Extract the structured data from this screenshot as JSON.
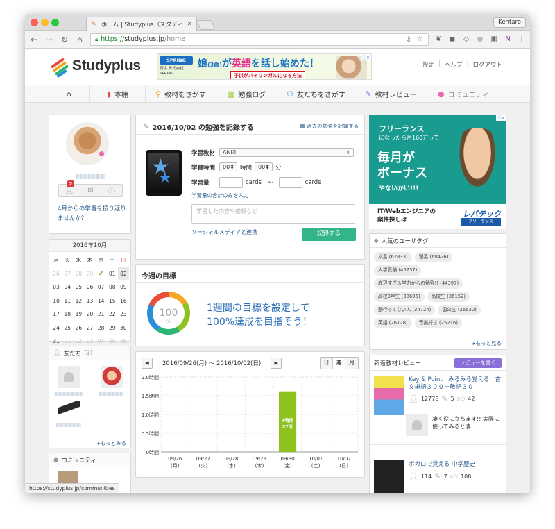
{
  "browser": {
    "tab_title": "ホーム | Studyplus（スタディプ",
    "user": "Kentaro",
    "url_scheme": "https://",
    "url_host": "studyplus.jp",
    "url_path": "/home",
    "status_url": "https://studyplus.jp/communities"
  },
  "header": {
    "logo": "Studyplus",
    "ad": {
      "brand": "SPRING",
      "brand_sub": "提供 株式会社SPRING",
      "headline_a": "娘",
      "headline_age": "(3歳)",
      "headline_b": "が",
      "headline_c": "英語",
      "headline_d": "を話し始めた！",
      "subline": "子供がバイリンガルになる方法"
    },
    "links": [
      "設定",
      "ヘルプ",
      "ログアウト"
    ]
  },
  "nav": [
    {
      "label": "",
      "icon": "home-icon"
    },
    {
      "label": "本棚",
      "icon": "book-icon"
    },
    {
      "label": "教材をさがす",
      "icon": "search-icon"
    },
    {
      "label": "勉強ログ",
      "icon": "bar-chart-icon"
    },
    {
      "label": "友だちをさがす",
      "icon": "find-friend-icon"
    },
    {
      "label": "教材レビュー",
      "icon": "review-icon"
    },
    {
      "label": "コミュニティ",
      "icon": "speech-bubble-icon"
    }
  ],
  "profile": {
    "notification_count": "2",
    "prompt": "4月からの学習を振り返りませんか？"
  },
  "calendar": {
    "month": "2016年10月",
    "weekdays": [
      "月",
      "火",
      "水",
      "木",
      "金",
      "土",
      "日"
    ],
    "days": [
      "26",
      "27",
      "28",
      "29",
      "✔",
      "01",
      "02",
      "03",
      "04",
      "05",
      "06",
      "07",
      "08",
      "09",
      "10",
      "11",
      "12",
      "13",
      "14",
      "15",
      "16",
      "17",
      "18",
      "19",
      "20",
      "21",
      "22",
      "23",
      "24",
      "25",
      "26",
      "27",
      "28",
      "29",
      "30",
      "31",
      "01",
      "02",
      "03",
      "04",
      "05",
      "06"
    ]
  },
  "friends": {
    "title": "友だち",
    "count": "(3)",
    "more": "▸もっとみる"
  },
  "community": {
    "title": "コミュニティ"
  },
  "record": {
    "title": "2016/10/02 の勉強を記録する",
    "past_link": "過去の勉強を記録する",
    "material_label": "学習教材",
    "material_value": "ANKI",
    "time_label": "学習時間",
    "hours": "00",
    "hour_unit": "時間",
    "minutes": "00",
    "minute_unit": "分",
    "amount_label": "学習量",
    "unit_a": "cards",
    "tilde": "〜",
    "unit_b": "cards",
    "total_only_link": "学習量の合計のみを入力",
    "textarea_placeholder": "学習した内容や感想など",
    "social_link": "ソーシャルメディアと連携",
    "submit": "記録する"
  },
  "goal": {
    "title": "今週の目標",
    "gauge_value": "100",
    "gauge_unit": "%",
    "line1": "1週間の目標を設定して",
    "line2": "100%達成を目指そう！"
  },
  "chart_controls": {
    "prev": "◀",
    "next": "▶",
    "range": "2016/09/26(月) 〜 2016/10/02(日)",
    "views": [
      "日",
      "週",
      "月"
    ]
  },
  "chart_data": {
    "type": "bar",
    "categories": [
      "09/26\n(月)",
      "09/27\n(火)",
      "09/28\n(水)",
      "09/29\n(木)",
      "09/30\n(金)",
      "10/01\n(土)",
      "10/02\n(日)"
    ],
    "values": [
      0,
      0,
      0,
      0,
      1.617,
      0,
      0
    ],
    "data_labels": [
      "",
      "",
      "",
      "",
      "1時間37分",
      "",
      ""
    ],
    "ylim": [
      0,
      2.0
    ],
    "yticks": [
      "0時間",
      "0.5時間",
      "1.0時間",
      "1.5時間",
      "2.0時間"
    ],
    "bar_color": "#8dc21f"
  },
  "right_ad": {
    "l1": "フリーランス",
    "l2": "になったら月160万って",
    "l3": "毎月が",
    "l4": "ボーナス",
    "l5": "やないかい!!!",
    "bottom_l1": "IT/Webエンジニアの",
    "bottom_l2": "案件探しは",
    "brand": "レバテック",
    "brand_sub": "フリーランス"
  },
  "tags": {
    "title": "人気のユーザタグ",
    "items": [
      "文系 (62833)",
      "理系 (60426)",
      "大学受験 (45237)",
      "底辺すぎる学力からの勉強!! (44397)",
      "高校3年生 (38695)",
      "高校生 (36152)",
      "勤行ってない人 (34724)",
      "国公立 (26530)",
      "英語 (26128)",
      "音楽好き (25216)"
    ],
    "more": "▸もっと見る"
  },
  "reviews": {
    "title": "新着教材レビュー",
    "write_button": "レビューを書く",
    "items": [
      {
        "title": "Key & Point　みるみる覚える　古文単語３００＋敬語３０",
        "users": "12778",
        "reviews": "5",
        "likes": "42",
        "comment": "凄く役に立ちます!! 実際に使ってみると凄..."
      },
      {
        "title": "ボカロで覚える 中学歴史",
        "users": "114",
        "reviews": "7",
        "likes": "108"
      }
    ]
  }
}
